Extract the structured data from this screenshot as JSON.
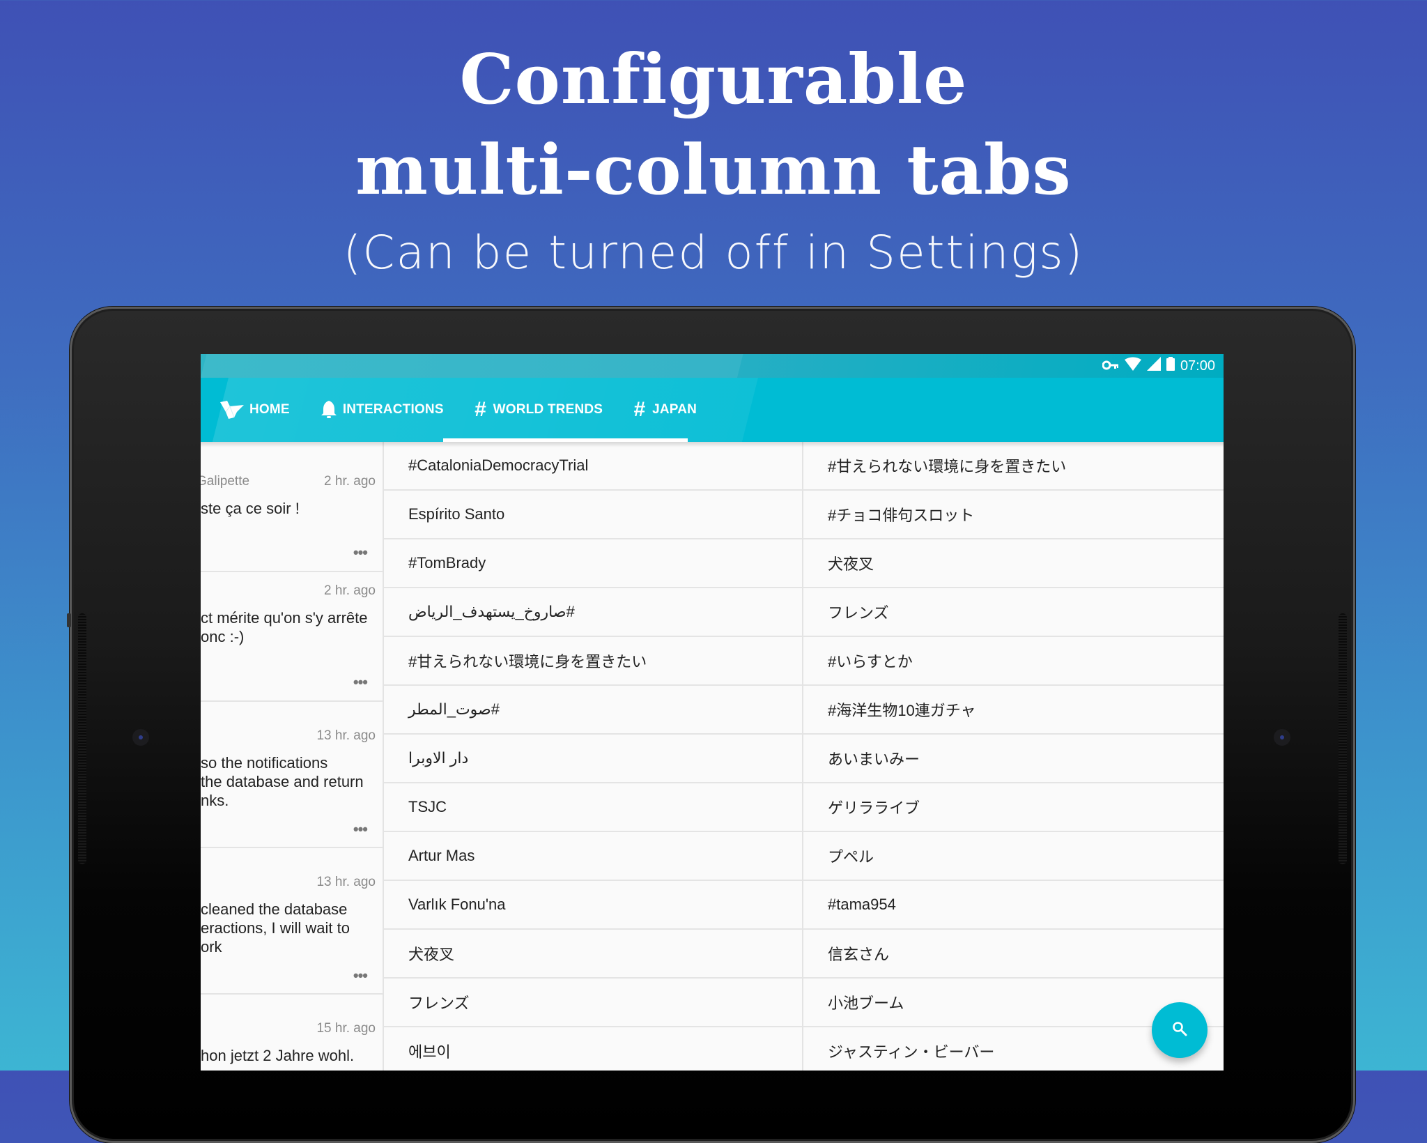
{
  "promo": {
    "title_line1": "Configurable",
    "title_line2": "multi-column tabs",
    "subtitle": "(Can be turned off in Settings)"
  },
  "status_bar": {
    "icons": [
      "vpn-key-icon",
      "wifi-icon",
      "cellular-signal-icon",
      "battery-icon"
    ],
    "time": "07:00"
  },
  "tabs": [
    {
      "label": "HOME",
      "icon": "bird-icon",
      "active": false
    },
    {
      "label": "INTERACTIONS",
      "icon": "bell-icon",
      "active": false
    },
    {
      "label": "WORLD TRENDS",
      "icon": "hashtag-icon",
      "active": true
    },
    {
      "label": "JAPAN",
      "icon": "hashtag-icon",
      "active": true
    }
  ],
  "colors": {
    "accent": "#00bcd4",
    "background_top": "#3f51b5",
    "background_bottom": "#3db5d3"
  },
  "timeline": [
    {
      "name": "Galipette",
      "time": "2 hr. ago",
      "text": "ste ça ce soir !"
    },
    {
      "name": "",
      "time": "2 hr. ago",
      "text": "ct mérite qu'on s'y arrête\nonc :-)"
    },
    {
      "name": "",
      "time": "13 hr. ago",
      "text": "so the notifications\nthe database and return\nnks."
    },
    {
      "name": "",
      "time": "13 hr. ago",
      "text": "cleaned the database\neractions, I will wait to\nork"
    },
    {
      "name": "",
      "time": "15 hr. ago",
      "text": "hon jetzt 2 Jahre wohl."
    }
  ],
  "world_trends": [
    {
      "text": "#CataloniaDemocracyTrial",
      "rtl": false
    },
    {
      "text": "Espírito Santo",
      "rtl": false
    },
    {
      "text": "#TomBrady",
      "rtl": false
    },
    {
      "text": "#صاروخ_يستهدف_الرياض",
      "rtl": true
    },
    {
      "text": "#甘えられない環境に身を置きたい",
      "rtl": false
    },
    {
      "text": "#صوت_المطر",
      "rtl": true
    },
    {
      "text": "دار الاوبرا",
      "rtl": true
    },
    {
      "text": "TSJC",
      "rtl": false
    },
    {
      "text": "Artur Mas",
      "rtl": false
    },
    {
      "text": "Varlık Fonu'na",
      "rtl": false
    },
    {
      "text": "犬夜叉",
      "rtl": false
    },
    {
      "text": "フレンズ",
      "rtl": false
    },
    {
      "text": "에브이",
      "rtl": false
    }
  ],
  "japan_trends": [
    {
      "text": "#甘えられない環境に身を置きたい"
    },
    {
      "text": "#チョコ俳句スロット"
    },
    {
      "text": "犬夜叉"
    },
    {
      "text": "フレンズ"
    },
    {
      "text": "#いらすとか"
    },
    {
      "text": "#海洋生物10連ガチャ"
    },
    {
      "text": "あいまいみー"
    },
    {
      "text": "ゲリラライブ"
    },
    {
      "text": "プペル"
    },
    {
      "text": "#tama954"
    },
    {
      "text": "信玄さん"
    },
    {
      "text": "小池ブーム"
    },
    {
      "text": "ジャスティン・ビーバー"
    }
  ],
  "fab": {
    "icon": "search-icon"
  }
}
